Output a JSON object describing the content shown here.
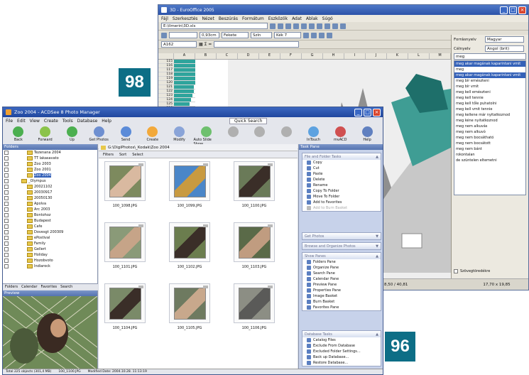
{
  "badges": {
    "top": "98",
    "bottom": "96"
  },
  "euro": {
    "title": "3D - EuroOffice 2005",
    "menu": [
      "Fájl",
      "Szerkesztés",
      "Nézet",
      "Beszúrás",
      "Formátum",
      "Eszközök",
      "Adat",
      "Ablak",
      "Súgó"
    ],
    "path": "E:\\Ilmerin\\3D.xls",
    "zoom": "0,93cm",
    "line_style": "Fekete",
    "fill_label": "Szín",
    "kek": "Kék 7",
    "cell_ref": "A162",
    "columns": [
      "A",
      "B",
      "C",
      "D",
      "E",
      "F",
      "G",
      "H",
      "I",
      "J",
      "K",
      "L",
      "M"
    ],
    "row_numbers": [
      "115",
      "116",
      "117",
      "118",
      "119",
      "120",
      "121",
      "122",
      "123",
      "124",
      "125",
      "126",
      "127",
      "128",
      "129",
      "130",
      "131",
      "132",
      "133",
      "134",
      "135"
    ],
    "row_widths": [
      30,
      30,
      30,
      30,
      30,
      30,
      28,
      28,
      26,
      24,
      22,
      20,
      18,
      16,
      14,
      12,
      10,
      8,
      6,
      5,
      4
    ],
    "panel": {
      "forrasnyelv_label": "Forrásnyelv",
      "forrasnyelv_value": "Magyar",
      "celnyelv_label": "Célnyelv",
      "celnyelv_value": "Angol (brit)",
      "search_value": "meg",
      "list": [
        "meg akar magának kaparintani vmit",
        "meg",
        "meg akar magának kaparintani vmit",
        "meg bír emészteni",
        "meg bír vmit",
        "meg kell emészteni",
        "meg kell tennie",
        "meg kell tőle puhatolni",
        "meg kell vmit tennie",
        "meg kellene már nyitatkoznod",
        "meg kéne nyitatkoznod",
        "meg nem alkuvás",
        "meg nem alkuvó",
        "meg nem bocsátható",
        "meg nem bocsátott",
        "meg nem bánt",
        "rokontalan",
        "de szüntelen eltemetni"
      ],
      "list_highlight": [
        0,
        2
      ],
      "checkbox_label": "Szövegtöredékre"
    },
    "status": {
      "pos": "8,50 / 40,81",
      "size": "17,70 x 19,85"
    }
  },
  "acdsee": {
    "title": "Zoo 2004 - ACDSee 8 Photo Manager",
    "menu": [
      "File",
      "Edit",
      "View",
      "Create",
      "Tools",
      "Database",
      "Help"
    ],
    "quick_search": "Quick Search",
    "toolbar": [
      "Back",
      "Forward",
      "Up",
      "Get Photos",
      "Send",
      "Create",
      "Modify",
      "Auto Slide Show",
      "",
      "",
      "",
      "InTouch",
      "mvACD",
      "Help"
    ],
    "folders_header": "Folders",
    "folders": [
      {
        "label": "Tezenana 2004",
        "indent": 3
      },
      {
        "label": "TT lakasavato",
        "indent": 3
      },
      {
        "label": "Zoo 2003",
        "indent": 3
      },
      {
        "label": "Zoo 2001",
        "indent": 3
      },
      {
        "label": "Zoo 2004",
        "indent": 3
      },
      {
        "label": "_Olympus",
        "indent": 2
      },
      {
        "label": "20021102",
        "indent": 3
      },
      {
        "label": "20030917",
        "indent": 3
      },
      {
        "label": "20050130",
        "indent": 3
      },
      {
        "label": "Apolva",
        "indent": 3
      },
      {
        "label": "Arc 2003",
        "indent": 3
      },
      {
        "label": "Bontohoz",
        "indent": 3
      },
      {
        "label": "Budapest",
        "indent": 3
      },
      {
        "label": "Cafe",
        "indent": 3
      },
      {
        "label": "Dovesgt 200309",
        "indent": 3
      },
      {
        "label": "ePostival",
        "indent": 3
      },
      {
        "label": "Family",
        "indent": 3
      },
      {
        "label": "Gellert",
        "indent": 3
      },
      {
        "label": "Holiday",
        "indent": 3
      },
      {
        "label": "Hozobvoto",
        "indent": 3
      },
      {
        "label": "Indiarock",
        "indent": 3
      }
    ],
    "folder_tabs": [
      "Folders",
      "Calendar",
      "Favorites",
      "Search"
    ],
    "preview_header": "Preview",
    "path": "G:\\DigiPhotos\\_Kodak\\Zoo 2004",
    "filter_bar": [
      "Filters",
      "Sort",
      "Select"
    ],
    "thumbs": [
      "100_1098.JPG",
      "100_1099.JPG",
      "100_1100.JPG",
      "100_1101.JPG",
      "100_1102.JPG",
      "100_1103.JPG",
      "100_1104.JPG",
      "100_1105.JPG",
      "100_1106.JPG"
    ],
    "task_header": "Task Pane",
    "task_groups": [
      {
        "title": "File and Folder Tasks",
        "items": [
          "Copy",
          "Cut",
          "Paste",
          "Delete",
          "Rename",
          "Copy To Folder",
          "Move To Folder",
          "Add to Favorites",
          "Add to Burn Basket"
        ]
      },
      {
        "title": "Get Photos",
        "items": []
      },
      {
        "title": "Browse and Organize Photos",
        "items": []
      },
      {
        "title": "Show Panes",
        "items": [
          "Folders Pane",
          "Organize Pane",
          "Search Pane",
          "Calendar Pane",
          "Preview Pane",
          "Properties Pane",
          "Image Basket",
          "Burn Basket",
          "Favorites Pane"
        ]
      },
      {
        "title": "Database Tasks",
        "items": [
          "Catalog Files",
          "Exclude From Database",
          "Excluded Folder Settings...",
          "Back up Database...",
          "Restore Database..."
        ]
      }
    ],
    "status": [
      "Total 225 objects (301,4 MB)",
      "100_1100.JPG",
      "Modified Date: 2004.10.28. 11:13:19"
    ]
  }
}
